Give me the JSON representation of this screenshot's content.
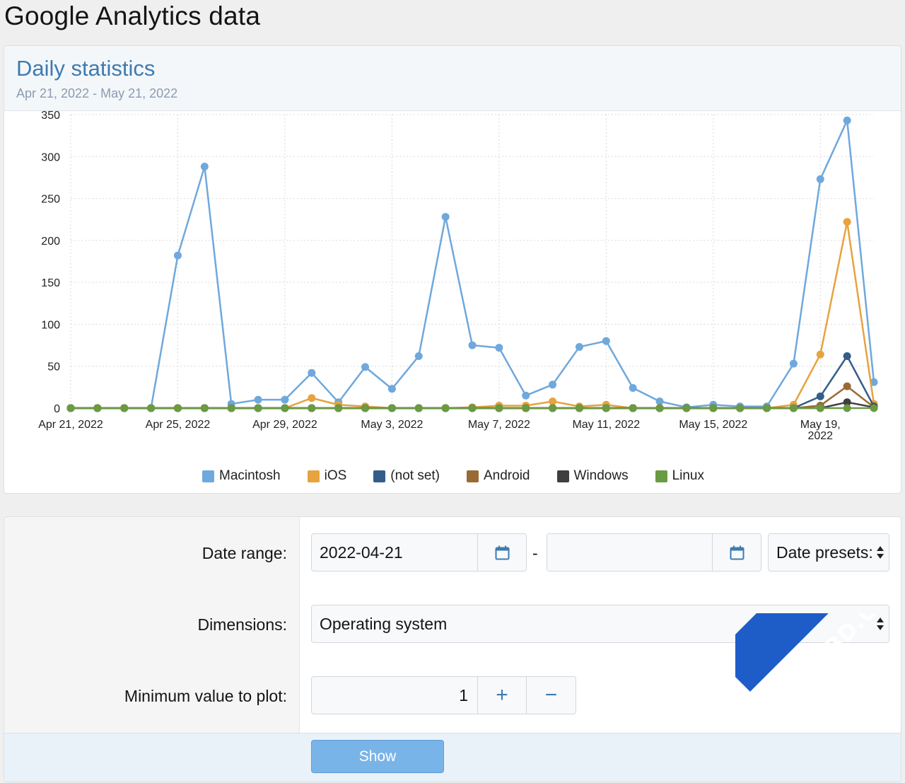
{
  "page": {
    "title": "Google Analytics data"
  },
  "stats": {
    "title": "Daily statistics",
    "date_range": "Apr 21, 2022 - May 21, 2022"
  },
  "chart_data": {
    "type": "line",
    "title": "",
    "xlabel": "",
    "ylabel": "",
    "ylim": [
      0,
      350
    ],
    "yticks": [
      "0",
      "50",
      "100",
      "150",
      "200",
      "250",
      "300",
      "350"
    ],
    "x": [
      "Apr 21, 2022",
      "Apr 22, 2022",
      "Apr 23, 2022",
      "Apr 24, 2022",
      "Apr 25, 2022",
      "Apr 26, 2022",
      "Apr 27, 2022",
      "Apr 28, 2022",
      "Apr 29, 2022",
      "Apr 30, 2022",
      "May 1, 2022",
      "May 2, 2022",
      "May 3, 2022",
      "May 4, 2022",
      "May 5, 2022",
      "May 6, 2022",
      "May 7, 2022",
      "May 8, 2022",
      "May 9, 2022",
      "May 10, 2022",
      "May 11, 2022",
      "May 12, 2022",
      "May 13, 2022",
      "May 14, 2022",
      "May 15, 2022",
      "May 16, 2022",
      "May 17, 2022",
      "May 18, 2022",
      "May 19, 2022",
      "May 20, 2022",
      "May 21, 2022"
    ],
    "xtick_labels": [
      {
        "index": 0,
        "label": "Apr 21, 2022"
      },
      {
        "index": 4,
        "label": "Apr 25, 2022"
      },
      {
        "index": 8,
        "label": "Apr 29, 2022"
      },
      {
        "index": 12,
        "label": "May 3, 2022"
      },
      {
        "index": 16,
        "label": "May 7, 2022"
      },
      {
        "index": 20,
        "label": "May 11, 2022"
      },
      {
        "index": 24,
        "label": "May 15, 2022"
      },
      {
        "index": 28,
        "label": "May 19,\n2022"
      }
    ],
    "grid": true,
    "legend_position": "bottom",
    "series": [
      {
        "name": "Macintosh",
        "color": "#6fa8dc",
        "values": [
          0,
          0,
          0,
          0,
          182,
          288,
          5,
          10,
          10,
          42,
          7,
          49,
          23,
          62,
          228,
          75,
          72,
          15,
          28,
          73,
          80,
          24,
          8,
          1,
          4,
          2,
          2,
          53,
          273,
          343,
          31
        ]
      },
      {
        "name": "iOS",
        "color": "#e6a33e",
        "values": [
          0,
          0,
          0,
          0,
          0,
          0,
          0,
          0,
          0,
          12,
          4,
          2,
          0,
          0,
          0,
          1,
          3,
          3,
          8,
          2,
          4,
          0,
          0,
          0,
          0,
          0,
          0,
          4,
          64,
          222,
          5
        ]
      },
      {
        "name": "(not set)",
        "color": "#345d8a",
        "values": [
          0,
          0,
          0,
          0,
          0,
          0,
          0,
          0,
          0,
          0,
          0,
          0,
          0,
          0,
          0,
          0,
          0,
          0,
          0,
          0,
          0,
          0,
          0,
          0,
          0,
          0,
          0,
          0,
          14,
          62,
          2
        ]
      },
      {
        "name": "Android",
        "color": "#9a6a36",
        "values": [
          0,
          0,
          0,
          0,
          0,
          0,
          0,
          0,
          0,
          0,
          0,
          0,
          0,
          0,
          0,
          0,
          0,
          0,
          0,
          0,
          0,
          0,
          0,
          0,
          0,
          0,
          0,
          0,
          3,
          26,
          1
        ]
      },
      {
        "name": "Windows",
        "color": "#3f3f3f",
        "values": [
          0,
          0,
          0,
          0,
          0,
          0,
          0,
          0,
          0,
          0,
          0,
          0,
          0,
          0,
          0,
          0,
          0,
          0,
          0,
          0,
          0,
          0,
          0,
          0,
          0,
          0,
          0,
          0,
          0,
          7,
          1
        ]
      },
      {
        "name": "Linux",
        "color": "#6a9a42",
        "values": [
          0,
          0,
          0,
          0,
          0,
          0,
          0,
          0,
          0,
          0,
          0,
          0,
          0,
          0,
          0,
          0,
          0,
          0,
          0,
          0,
          0,
          0,
          0,
          0,
          0,
          0,
          0,
          0,
          0,
          0,
          0
        ]
      }
    ]
  },
  "form": {
    "date_range_label": "Date range:",
    "start_date": "2022-04-21",
    "date_separator": "-",
    "end_date": "",
    "date_presets": "Date presets:",
    "dimensions_label": "Dimensions:",
    "dimensions_value": "Operating system",
    "min_value_label": "Minimum value to plot:",
    "min_value": "1",
    "plus_symbol": "+",
    "minus_symbol": "−",
    "show_label": "Show"
  },
  "icons": {
    "calendar": "calendar-icon",
    "increment": "plus-icon",
    "decrement": "minus-icon",
    "select": "select-arrows-icon"
  },
  "watermark": {
    "text": "XenBD.Com"
  }
}
